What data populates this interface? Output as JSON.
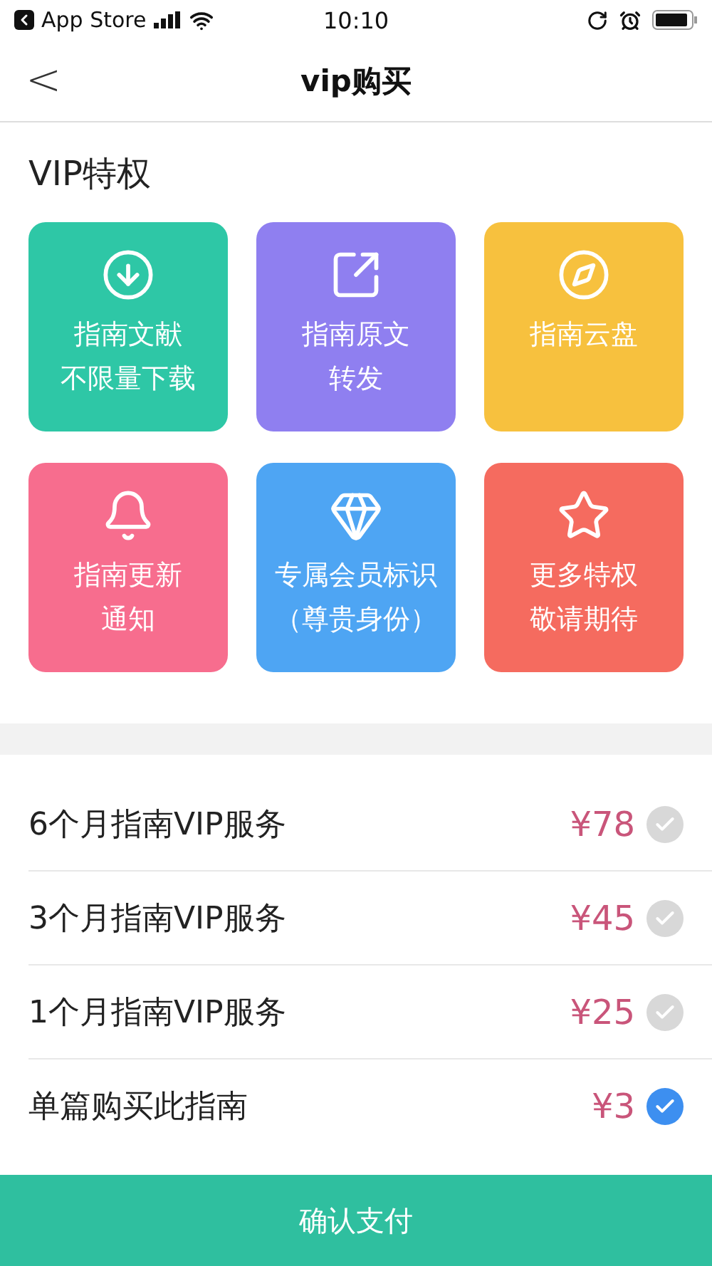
{
  "status_bar": {
    "back_app": "App Store",
    "time": "10:10"
  },
  "nav": {
    "back": "<",
    "title": "vip购买"
  },
  "section_title": "VIP特权",
  "perks": [
    {
      "lines": [
        "指南文献",
        "不限量下载"
      ],
      "color": "#2ec7a6"
    },
    {
      "lines": [
        "指南原文",
        "转发"
      ],
      "color": "#8f7ff0"
    },
    {
      "lines": [
        "指南云盘"
      ],
      "color": "#f7c13e"
    },
    {
      "lines": [
        "指南更新",
        "通知"
      ],
      "color": "#f76d8e"
    },
    {
      "lines": [
        "专属会员标识",
        "（尊贵身份）"
      ],
      "color": "#4ea5f3"
    },
    {
      "lines": [
        "更多特权",
        "敬请期待"
      ],
      "color": "#f56b5f"
    }
  ],
  "plans": [
    {
      "name": "6个月指南VIP服务",
      "price": "¥78",
      "selected": false
    },
    {
      "name": "3个月指南VIP服务",
      "price": "¥45",
      "selected": false
    },
    {
      "name": "1个月指南VIP服务",
      "price": "¥25",
      "selected": false
    },
    {
      "name": "单篇购买此指南",
      "price": "¥3",
      "selected": true
    }
  ],
  "confirm_button": "确认支付"
}
